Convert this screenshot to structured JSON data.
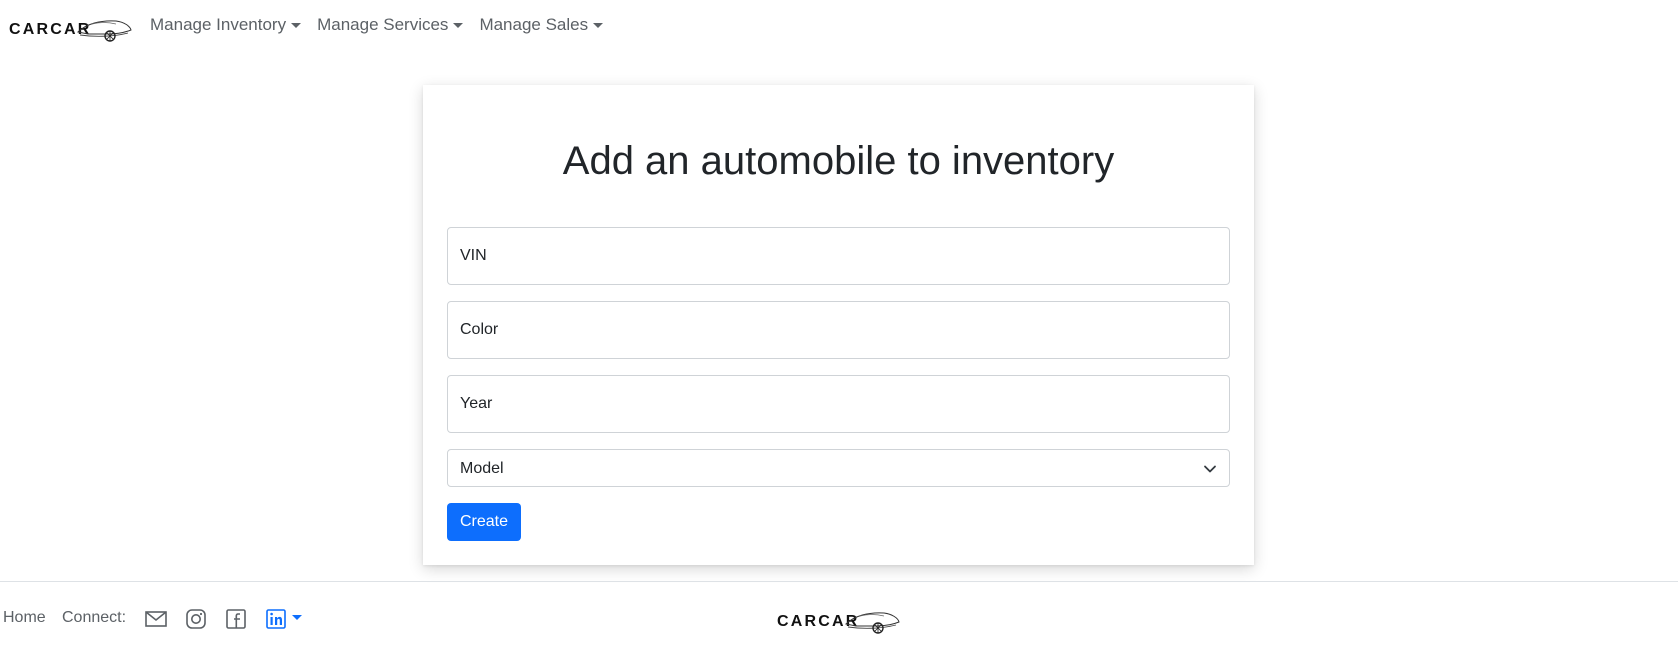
{
  "brand": {
    "name": "CARCAR"
  },
  "nav": {
    "items": [
      {
        "label": "Manage Inventory"
      },
      {
        "label": "Manage Services"
      },
      {
        "label": "Manage Sales"
      }
    ]
  },
  "form": {
    "title": "Add an automobile to inventory",
    "vin_placeholder": "VIN",
    "color_placeholder": "Color",
    "year_placeholder": "Year",
    "model_selected": "Model",
    "submit_label": "Create"
  },
  "footer": {
    "home_label": "Home",
    "connect_label": "Connect:",
    "icons": [
      "mail-icon",
      "instagram-icon",
      "facebook-icon",
      "linkedin-icon"
    ],
    "logo": "CARCAR"
  },
  "colors": {
    "primary": "#0d6efd",
    "nav_text": "#5c6166",
    "border": "#cfd3d7"
  }
}
